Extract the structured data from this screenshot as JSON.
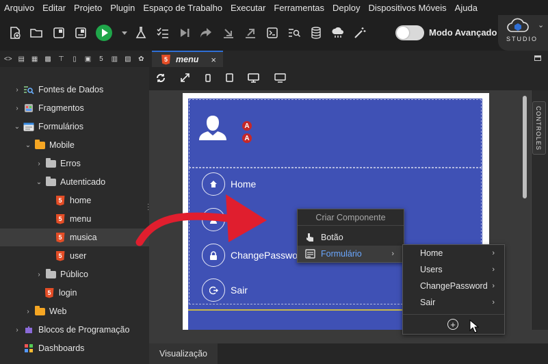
{
  "menubar": {
    "items": [
      "Arquivo",
      "Editar",
      "Projeto",
      "Plugin",
      "Espaço de Trabalho",
      "Executar",
      "Ferramentas",
      "Deploy",
      "Dispositivos Móveis",
      "Ajuda"
    ]
  },
  "toolbar": {
    "icons": [
      "new-file-icon",
      "open-folder-icon",
      "window-icon",
      "save-icon",
      "run-icon",
      "flask-icon",
      "checklist-icon",
      "step-icon",
      "share-icon",
      "download-icon",
      "upload-icon",
      "terminal-icon",
      "search-list-icon",
      "database-icon",
      "cloud-icon",
      "magic-wand-icon"
    ],
    "advanced_mode_label": "Modo Avançado",
    "advanced_mode_on": false,
    "brand": "STUDIO"
  },
  "tree": {
    "items": [
      {
        "label": "Fontes de Dados",
        "depth": 0
      },
      {
        "label": "Fragmentos",
        "depth": 0
      },
      {
        "label": "Formulários",
        "depth": 0
      },
      {
        "label": "Mobile",
        "depth": 1
      },
      {
        "label": "Erros",
        "depth": 2
      },
      {
        "label": "Autenticado",
        "depth": 2
      },
      {
        "label": "home",
        "depth": 3
      },
      {
        "label": "menu",
        "depth": 3
      },
      {
        "label": "musica",
        "depth": 3,
        "selected": true
      },
      {
        "label": "user",
        "depth": 3
      },
      {
        "label": "Público",
        "depth": 2
      },
      {
        "label": "login",
        "depth": 2
      },
      {
        "label": "Web",
        "depth": 1
      },
      {
        "label": "Blocos de Programação",
        "depth": 0
      },
      {
        "label": "Dashboards",
        "depth": 0
      }
    ]
  },
  "editor": {
    "tab_label": "menu",
    "tab_close": "×",
    "bottom_tab": "Visualização",
    "side_panel_label": "CONTROLES"
  },
  "preview": {
    "badges": [
      "A",
      "A"
    ],
    "nav": [
      {
        "label": "Home",
        "icon": "home-icon"
      },
      {
        "label": "",
        "icon": "user-icon"
      },
      {
        "label": "ChangePassword",
        "icon": "lock-icon"
      },
      {
        "label": "Sair",
        "icon": "logout-icon"
      }
    ]
  },
  "context_menu": {
    "header": "Criar Componente",
    "items": [
      {
        "label": "Botão",
        "icon": "pointer-hand-icon"
      },
      {
        "label": "Formulário",
        "icon": "form-icon",
        "highlighted": true
      }
    ]
  },
  "submenu": {
    "items": [
      "Home",
      "Users",
      "ChangePassword",
      "Sair"
    ],
    "add_symbol": "+"
  },
  "colors": {
    "accent_blue": "#2f6fd6",
    "preview_bg": "#3f51b5",
    "run_green": "#1fa64a",
    "html5_orange": "#e44d26",
    "arrow_red": "#e01e2e",
    "menu_highlight_text": "#6aa7ff"
  }
}
